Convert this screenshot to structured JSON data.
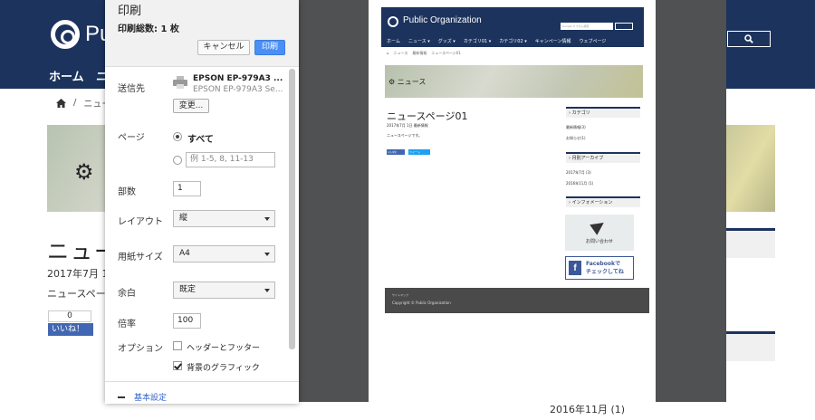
{
  "background_page": {
    "logo_text": "Pu",
    "nav": [
      "ホーム",
      "ニ"
    ],
    "breadcrumb": "ニュー",
    "title": "ニュー",
    "date": "2017年7月 1",
    "body": "ニュースペー",
    "like_count": "0",
    "like_label": "いいね！",
    "archive_item": "2016年11月 (1)"
  },
  "dialog": {
    "title": "印刷",
    "sheets": "印刷総数: 1 枚",
    "cancel_label": "キャンセル",
    "print_label": "印刷",
    "destination": {
      "label": "送信先",
      "printer_name": "EPSON EP-979A3 ...",
      "printer_sub": "EPSON EP-979A3 Se...",
      "change_label": "変更..."
    },
    "pages": {
      "label": "ページ",
      "all_label": "すべて",
      "range_placeholder": "例 1-5, 8, 11-13"
    },
    "copies": {
      "label": "部数",
      "value": "1"
    },
    "layout": {
      "label": "レイアウト",
      "value": "縦"
    },
    "paper": {
      "label": "用紙サイズ",
      "value": "A4"
    },
    "margins": {
      "label": "余白",
      "value": "既定"
    },
    "scale": {
      "label": "倍率",
      "value": "100"
    },
    "options": {
      "label": "オプション",
      "headers_label": "ヘッダーとフッター",
      "headers_checked": false,
      "background_label": "背景のグラフィック",
      "background_checked": true
    },
    "basic_settings": "基本設定"
  },
  "preview": {
    "logo_text": "Public Organization",
    "search_placeholder": "Google カスタム検索",
    "nav": [
      "ホーム",
      "ニュース ▾",
      "グッズ ▾",
      "カテゴリ01 ▾",
      "カテゴリ02 ▾",
      "キャンペーン情報",
      "ウェブページ"
    ],
    "breadcrumb": [
      "ニュース",
      "最新情報",
      "ニュースページ01"
    ],
    "hero_text": "ニュース",
    "title": "ニュースページ01",
    "date": "2017年7月 1日  最新情報",
    "body": "ニュースページです。",
    "like_label": "いいね！",
    "tweet_label": "ツイート",
    "sidebar": {
      "category_head": "カテゴリ",
      "categories": [
        "最新情報(3)",
        "お知らせ(1)"
      ],
      "archive_head": "月別アーカイブ",
      "archives": [
        "2017年7月 (3)",
        "2016年11月 (1)"
      ],
      "info_head": "インフォメーション",
      "contact_label": "お問い合わせ",
      "fb_line1": "Facebookで",
      "fb_line2": "チェックしてね"
    },
    "footer_sitemap": "サイトマップ",
    "footer_copyright": "Copyright © Public Organization"
  }
}
